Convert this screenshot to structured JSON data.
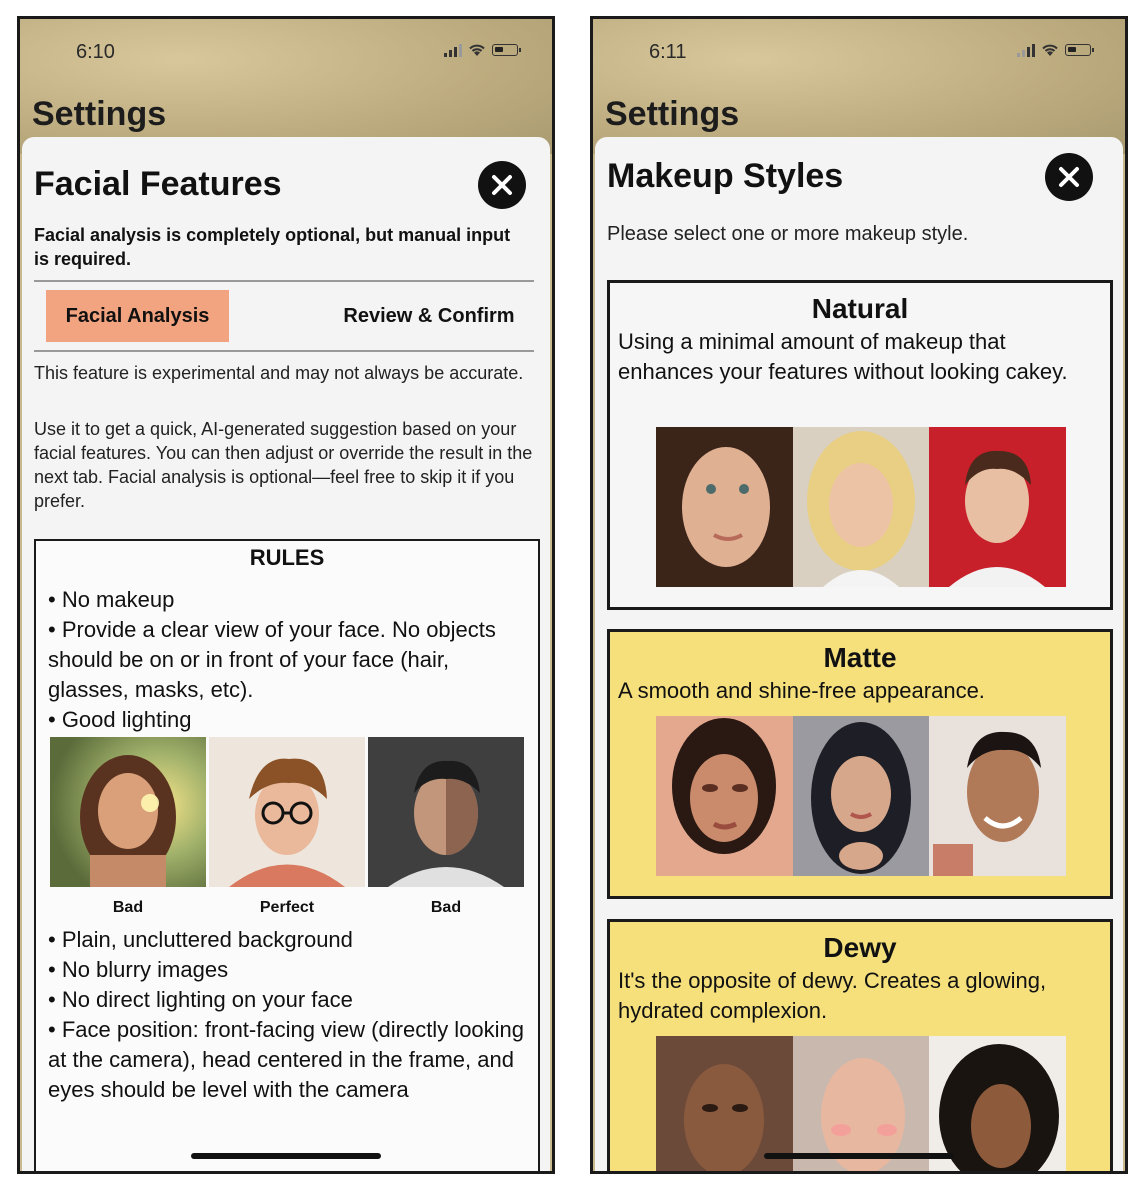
{
  "left": {
    "status_time": "6:10",
    "bg_title": "Settings",
    "title": "Facial Features",
    "intro": "Facial analysis is completely optional, but manual input is required.",
    "tabs": [
      "Facial Analysis",
      "Review & Confirm"
    ],
    "para1": "This feature is experimental and may not always be accurate.",
    "para2": "Use it to get a quick, AI-generated suggestion based on your facial features. You can then adjust or override the result in the next tab. Facial analysis is optional—feel free to skip it if you prefer.",
    "rules": {
      "title": "RULES",
      "items_top": [
        "• No makeup",
        "• Provide a clear view of your face. No objects should be on or in front of your face (hair, glasses, masks, etc).",
        "• Good lighting"
      ],
      "examples": [
        {
          "label": "Bad"
        },
        {
          "label": "Perfect"
        },
        {
          "label": "Bad"
        }
      ],
      "items_bottom": [
        "• Plain, uncluttered background",
        "• No blurry images",
        "• No direct lighting on your face",
        "• Face position: front-facing view (directly looking at the camera), head centered in the frame, and eyes should be level with the camera"
      ]
    }
  },
  "right": {
    "status_time": "6:11",
    "bg_title": "Settings",
    "title": "Makeup Styles",
    "subtitle": "Please select one or more makeup style.",
    "styles": [
      {
        "name": "Natural",
        "description": "Using a minimal amount of makeup that enhances your features without looking cakey.",
        "selected": false
      },
      {
        "name": "Matte",
        "description": "A smooth and shine-free appearance.",
        "selected": true
      },
      {
        "name": "Dewy",
        "description": "It's the opposite of dewy. Creates a glowing, hydrated complexion.",
        "selected": true
      }
    ]
  },
  "colors": {
    "tab_active": "#f2a37f",
    "selected_card": "#f5e07c",
    "sheet": "#f4f4f4"
  }
}
